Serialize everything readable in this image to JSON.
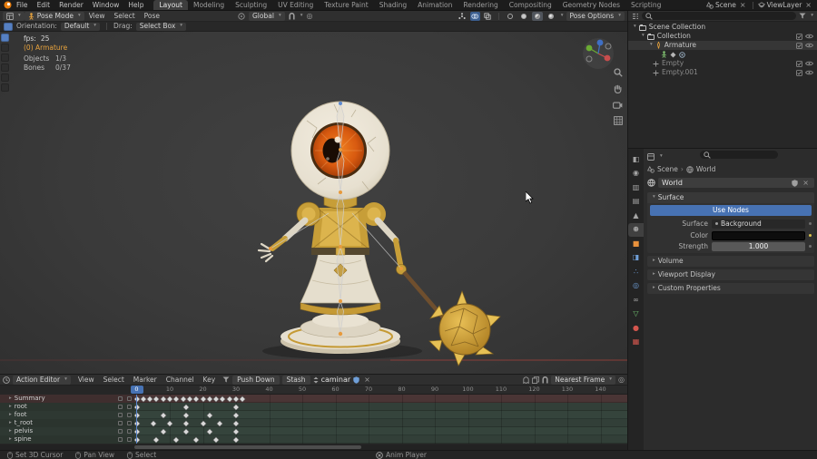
{
  "topbar": {
    "menus": [
      "File",
      "Edit",
      "Render",
      "Window",
      "Help"
    ],
    "workspaces": [
      "Layout",
      "Modeling",
      "Sculpting",
      "UV Editing",
      "Texture Paint",
      "Shading",
      "Animation",
      "Rendering",
      "Compositing",
      "Geometry Nodes",
      "Scripting"
    ],
    "active_workspace": "Layout",
    "scene_label": "Scene",
    "view_layer_label": "ViewLayer"
  },
  "viewport": {
    "mode": "Pose Mode",
    "menus": [
      "View",
      "Select",
      "Pose"
    ],
    "orientation": "Global",
    "pose_options_label": "Pose Options",
    "tool_settings": {
      "orientation_label": "Orientation:",
      "orientation_value": "Default",
      "drag_label": "Drag:",
      "drag_value": "Select Box"
    },
    "overlay_stats": {
      "fps_label": "fps:",
      "fps_value": "25",
      "active_object": "(0) Armature",
      "objects_label": "Objects",
      "objects_value": "1/3",
      "bones_label": "Bones",
      "bones_value": "0/37"
    }
  },
  "outliner": {
    "rows": [
      {
        "label": "Scene Collection",
        "icon": "collection",
        "depth": 0,
        "expanded": true,
        "toggles": false
      },
      {
        "label": "Collection",
        "icon": "collection",
        "depth": 1,
        "expanded": true,
        "toggles": true
      },
      {
        "label": "Armature",
        "icon": "armature",
        "depth": 2,
        "expanded": true,
        "toggles": true,
        "selected": true
      },
      {
        "icons": [
          "pose",
          "action",
          "constraint"
        ],
        "depth": 3,
        "toggles": false
      },
      {
        "label": "Empty",
        "icon": "empty",
        "depth": 2,
        "dim": true,
        "toggles": true
      },
      {
        "label": "Empty.001",
        "icon": "empty",
        "depth": 2,
        "dim": true,
        "toggles": true
      }
    ]
  },
  "properties": {
    "breadcrumb": [
      "Scene",
      "World"
    ],
    "datablock_name": "World",
    "tabs": [
      {
        "name": "tool"
      },
      {
        "name": "render"
      },
      {
        "name": "output"
      },
      {
        "name": "view-layer"
      },
      {
        "name": "scene"
      },
      {
        "name": "world",
        "active": true
      },
      {
        "name": "object"
      },
      {
        "name": "modifiers"
      },
      {
        "name": "particles"
      },
      {
        "name": "physics"
      },
      {
        "name": "constraints"
      },
      {
        "name": "object-data"
      },
      {
        "name": "material"
      },
      {
        "name": "texture"
      }
    ],
    "panels": {
      "surface": {
        "title": "Surface",
        "use_nodes_label": "Use Nodes",
        "rows": [
          {
            "label": "Surface",
            "value": "Background"
          },
          {
            "label": "Color",
            "value": ""
          },
          {
            "label": "Strength",
            "value": "1.000"
          }
        ]
      },
      "collapsed": [
        "Volume",
        "Viewport Display",
        "Custom Properties"
      ]
    }
  },
  "dope_sheet": {
    "editor_type": "Action Editor",
    "menus": [
      "View",
      "Select",
      "Marker",
      "Channel",
      "Key"
    ],
    "push_down_label": "Push Down",
    "stash_label": "Stash",
    "action_name": "caminar",
    "snap_value": "Nearest Frame",
    "current_frame": 0,
    "ruler": {
      "start": 10,
      "end": 140,
      "step": 10
    },
    "channels": [
      {
        "name": "Summary",
        "type": "summary",
        "keys": [
          0,
          2,
          4,
          6,
          8,
          10,
          12,
          14,
          16,
          18,
          20,
          22,
          24,
          26,
          28,
          30,
          32
        ]
      },
      {
        "name": "root",
        "type": "bone",
        "keys": [
          0,
          15,
          30
        ]
      },
      {
        "name": "foot",
        "type": "bone",
        "keys": [
          0,
          8,
          15,
          22,
          30
        ]
      },
      {
        "name": "t_root",
        "type": "bone",
        "keys": [
          0,
          5,
          10,
          15,
          20,
          25,
          30
        ]
      },
      {
        "name": "pelvis",
        "type": "bone",
        "keys": [
          0,
          8,
          15,
          22,
          30
        ]
      },
      {
        "name": "spine",
        "type": "bone",
        "keys": [
          0,
          6,
          12,
          18,
          24,
          30
        ]
      }
    ]
  },
  "status_bar": {
    "items_left": [
      "Set 3D Cursor",
      "Pan View",
      "Select"
    ],
    "player_label": "Anim Player"
  },
  "colors": {
    "accent_blue": "#4772b3",
    "playhead_blue": "#5a84cc",
    "armature_orange": "#e8a33d",
    "gold": "#c79e38"
  }
}
